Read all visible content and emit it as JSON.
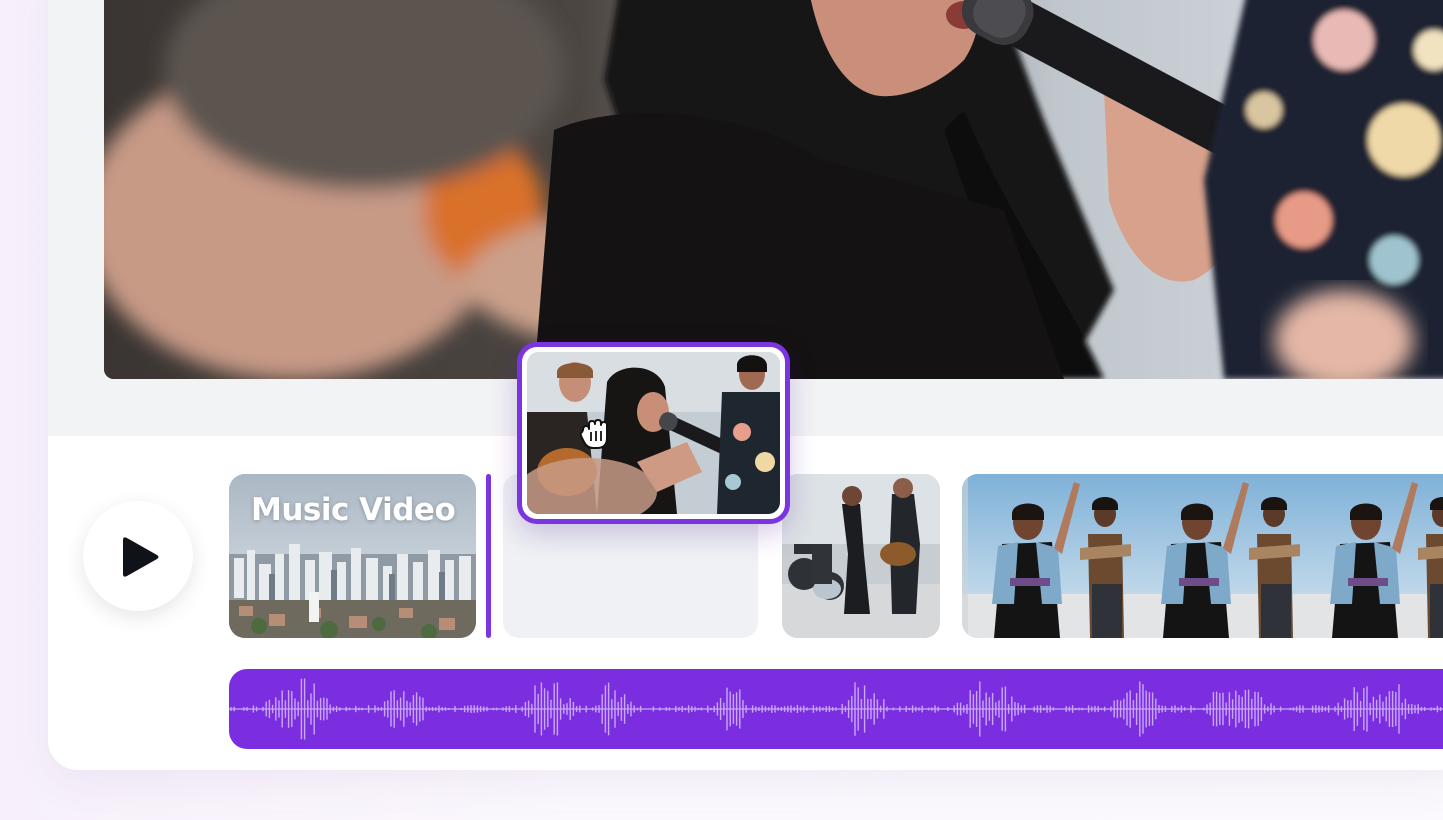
{
  "timeline": {
    "clips": [
      {
        "title": "Music Video",
        "type": "video",
        "icon": "city-skyline-thumbnail"
      },
      {
        "title": "",
        "type": "video",
        "icon": "band-performance-thumbnail"
      },
      {
        "title": "",
        "type": "video",
        "icon": "dancers-thumbnail"
      }
    ],
    "dragging_clip": {
      "icon": "singer-thumbnail"
    },
    "audio_track": {
      "icon": "waveform-icon"
    }
  },
  "colors": {
    "accent": "#7b35e0",
    "audio_track": "#7a2ee0",
    "waveform": "#c9a6f7",
    "panel": "#ffffff",
    "background": "#f2f3f5"
  },
  "icons": {
    "play": "play-icon",
    "cursor": "grab-hand-cursor-icon"
  }
}
